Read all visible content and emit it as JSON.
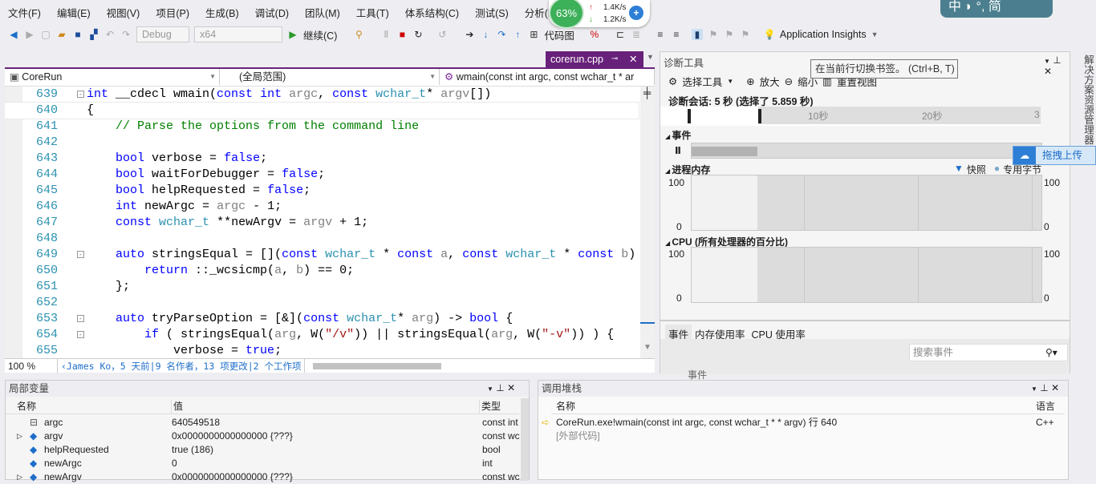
{
  "menu": [
    "文件(F)",
    "编辑(E)",
    "视图(V)",
    "项目(P)",
    "生成(B)",
    "调试(D)",
    "团队(M)",
    "工具(T)",
    "体系结构(C)",
    "测试(S)",
    "分析(N)"
  ],
  "net_widget": {
    "percent": "63%",
    "upload": "1.4K/s",
    "download": "1.2K/s"
  },
  "ime": "中 ◗ °, 简",
  "toolbar": {
    "config": "Debug",
    "platform": "x64",
    "continue": "继续(C)",
    "code_map": "代码图",
    "app_insights": "Application Insights"
  },
  "editor": {
    "tab": "corerun.cpp",
    "nav": {
      "project": "CoreRun",
      "scope": "(全局范围)",
      "function": "wmain(const int argc, const wchar_t * ar"
    },
    "current_line": "640",
    "lines": [
      {
        "n": "639",
        "fold": "⊟",
        "t": [
          [
            "int",
            "kw"
          ],
          " __cdecl wmain(",
          [
            "const",
            "kw"
          ],
          " ",
          [
            "int",
            "kw"
          ],
          " ",
          [
            "argc",
            "pa"
          ],
          ", ",
          [
            "const",
            "kw"
          ],
          " ",
          [
            "wchar_t",
            "ty"
          ],
          "* ",
          [
            "argv",
            "pa"
          ],
          "[])"
        ]
      },
      {
        "n": "640",
        "t": [
          "{"
        ]
      },
      {
        "n": "641",
        "t": [
          "    ",
          [
            "// Parse the options from the command line",
            "cm"
          ]
        ]
      },
      {
        "n": "642",
        "t": [
          ""
        ]
      },
      {
        "n": "643",
        "t": [
          "    ",
          [
            "bool",
            "kw"
          ],
          " verbose = ",
          [
            "false",
            "kw"
          ],
          ";"
        ]
      },
      {
        "n": "644",
        "t": [
          "    ",
          [
            "bool",
            "kw"
          ],
          " waitForDebugger = ",
          [
            "false",
            "kw"
          ],
          ";"
        ]
      },
      {
        "n": "645",
        "t": [
          "    ",
          [
            "bool",
            "kw"
          ],
          " helpRequested = ",
          [
            "false",
            "kw"
          ],
          ";"
        ]
      },
      {
        "n": "646",
        "t": [
          "    ",
          [
            "int",
            "kw"
          ],
          " newArgc = ",
          [
            "argc",
            "pa"
          ],
          " - 1;"
        ]
      },
      {
        "n": "647",
        "t": [
          "    ",
          [
            "const",
            "kw"
          ],
          " ",
          [
            "wchar_t",
            "ty"
          ],
          " **newArgv = ",
          [
            "argv",
            "pa"
          ],
          " + 1;"
        ]
      },
      {
        "n": "648",
        "t": [
          ""
        ]
      },
      {
        "n": "649",
        "fold": "⊟",
        "t": [
          "    ",
          [
            "auto",
            "kw"
          ],
          " stringsEqual = [](",
          [
            "const",
            "kw"
          ],
          " ",
          [
            "wchar_t",
            "ty"
          ],
          " * ",
          [
            "const",
            "kw"
          ],
          " ",
          [
            "a",
            "pa"
          ],
          ", ",
          [
            "const",
            "kw"
          ],
          " ",
          [
            "wchar_t",
            "ty"
          ],
          " * ",
          [
            "const",
            "kw"
          ],
          " ",
          [
            "b",
            "pa"
          ],
          ")"
        ]
      },
      {
        "n": "650",
        "t": [
          "        ",
          [
            "return",
            "kw"
          ],
          " ::_wcsicmp(",
          [
            "a",
            "pa"
          ],
          ", ",
          [
            "b",
            "pa"
          ],
          ") == 0;"
        ]
      },
      {
        "n": "651",
        "t": [
          "    };"
        ]
      },
      {
        "n": "652",
        "t": [
          ""
        ]
      },
      {
        "n": "653",
        "fold": "⊟",
        "t": [
          "    ",
          [
            "auto",
            "kw"
          ],
          " tryParseOption = [&](",
          [
            "const",
            "kw"
          ],
          " ",
          [
            "wchar_t",
            "ty"
          ],
          "* ",
          [
            "arg",
            "pa"
          ],
          ") -> ",
          [
            "bool",
            "kw"
          ],
          " {"
        ]
      },
      {
        "n": "654",
        "fold": "⊟",
        "t": [
          "        ",
          [
            "if",
            "kw"
          ],
          " ( stringsEqual(",
          [
            "arg",
            "pa"
          ],
          ", W(",
          [
            "\"/v\"",
            "st"
          ],
          ")) || stringsEqual(",
          [
            "arg",
            "pa"
          ],
          ", W(",
          [
            "\"-v\"",
            "st"
          ],
          ")) ) {"
        ]
      },
      {
        "n": "655",
        "t": [
          "            verbose = ",
          [
            "true",
            "kw"
          ],
          ";"
        ]
      }
    ],
    "zoom": "100 %",
    "codelens": "‹James Ko，5 天前|9 名作者，13 项更改|2 个工作项"
  },
  "diagnostics": {
    "title": "诊断工具",
    "select_tools": "选择工具",
    "zoom_in": "放大",
    "zoom_out": "缩小",
    "reset_view": "重置视图",
    "session": "诊断会话: 5 秒 (选择了 5.859 秒)",
    "ticks": [
      "10秒",
      "20秒",
      "3"
    ],
    "events_label": "事件",
    "memory_label": "进程内存",
    "legend": [
      "快照",
      "专用字节"
    ],
    "cpu_label": "CPU (所有处理器的百分比)",
    "axis_max": "100",
    "axis_min": "0",
    "tabs": [
      "事件",
      "内存使用率",
      "CPU 使用率"
    ],
    "search_placeholder": "搜索事件",
    "col_partial": "事件"
  },
  "tooltip": "在当前行切换书签。 (Ctrl+B, T)",
  "upload_btn": "拖拽上传",
  "side_tab": "解决方案资源管理器",
  "locals": {
    "title": "局部变量",
    "columns": [
      "名称",
      "值",
      "类型"
    ],
    "rows": [
      {
        "name": "argc",
        "value": "640549518",
        "type": "const int",
        "expand": false
      },
      {
        "name": "argv",
        "value": "0x0000000000000000 {???}",
        "type": "const wc",
        "expand": true
      },
      {
        "name": "helpRequested",
        "value": "true (186)",
        "type": "bool",
        "expand": false
      },
      {
        "name": "newArgc",
        "value": "0",
        "type": "int",
        "expand": false
      },
      {
        "name": "newArgv",
        "value": "0x0000000000000000 {???}",
        "type": "const wc",
        "expand": true
      }
    ]
  },
  "callstack": {
    "title": "调用堆栈",
    "columns": [
      "名称",
      "语言"
    ],
    "rows": [
      {
        "name": "CoreRun.exe!wmain(const int argc, const wchar_t * * argv) 行 640",
        "lang": "C++"
      },
      {
        "name": "[外部代码]",
        "lang": ""
      }
    ]
  },
  "colors": {
    "accent": "#68217a",
    "keyword": "#0000ff",
    "type": "#2b91af",
    "comment": "#008000"
  }
}
